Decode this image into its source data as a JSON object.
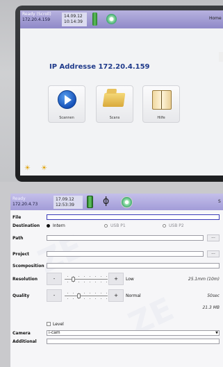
{
  "top_device": {
    "status": {
      "state": "Ready (Scroll)",
      "ip": "172.20.4.159",
      "date": "14.09.12",
      "time": "10:14:39",
      "home_label": "Home"
    },
    "title": "IP Addresse 172.20.4.159",
    "tiles": [
      {
        "label": "Scannen",
        "icon": "play-icon"
      },
      {
        "label": "Scans",
        "icon": "folder-icon"
      },
      {
        "label": "Hilfe",
        "icon": "book-icon"
      }
    ]
  },
  "screen": {
    "status": {
      "state": "Ready",
      "ip": "172.20.4.73",
      "date": "17.09.12",
      "time": "12:53:39",
      "right_label": "S"
    },
    "labels": {
      "file": "File",
      "destination": "Destination",
      "path": "Path",
      "project": "Project",
      "scomposition": "Scomposition",
      "resolution": "Resolution",
      "quality": "Quality",
      "camera": "Camera",
      "additional": "Additional"
    },
    "destination_options": [
      {
        "label": "Intern",
        "selected": true
      },
      {
        "label": "USB P1",
        "selected": false
      },
      {
        "label": "USB P2",
        "selected": false
      }
    ],
    "fields": {
      "file": "",
      "path": "",
      "project": "",
      "scomposition": "",
      "additional": ""
    },
    "browse_label": "...",
    "stepper": {
      "minus": "-",
      "plus": "+"
    },
    "resolution": {
      "setting": "Low",
      "value_text": "25.1mm (10m)",
      "slider_fraction": 0.2
    },
    "quality": {
      "setting": "Normal",
      "time_text": "50sec",
      "size_text": "21.3 MB",
      "slider_fraction": 0.33
    },
    "level_label": "Level",
    "level_checked": false,
    "camera_value": "i-cam",
    "colors": {
      "status_bar": "#a29cd8",
      "title_blue": "#1f3a8a"
    }
  }
}
